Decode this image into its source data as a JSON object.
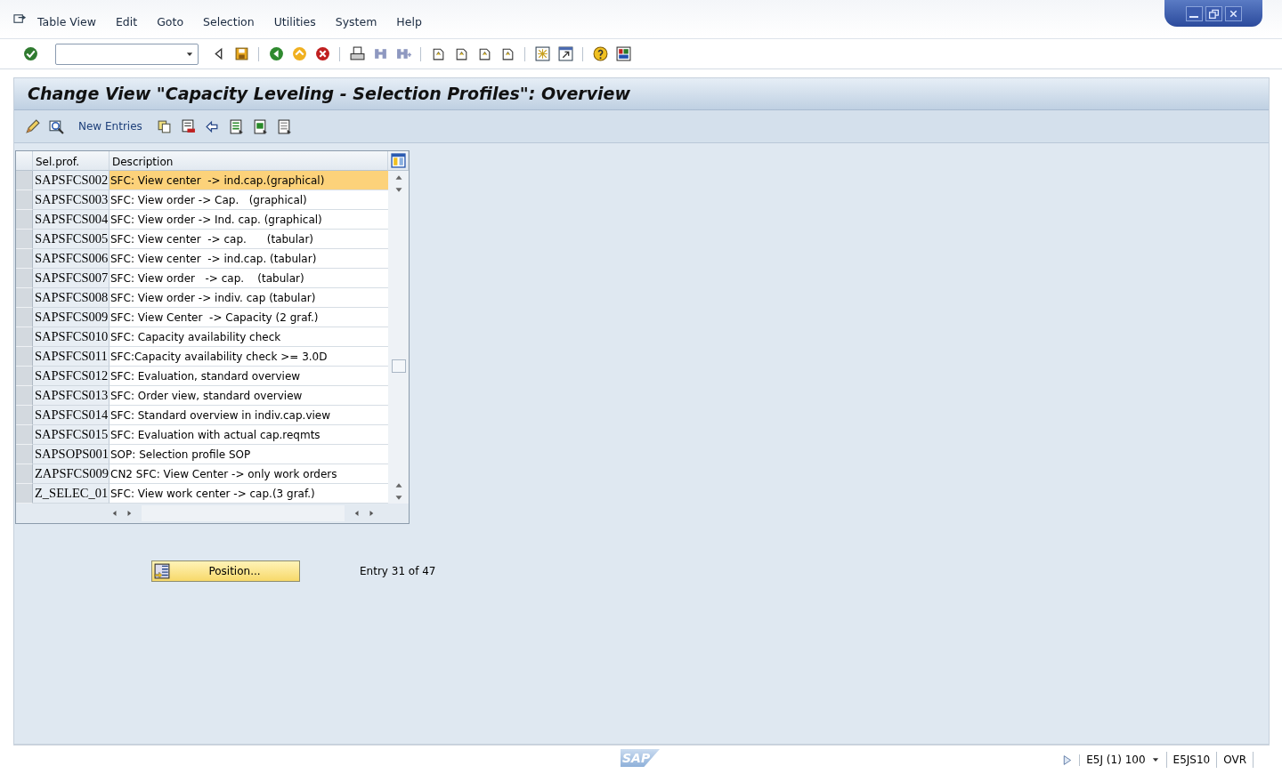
{
  "menu": [
    "Table View",
    "Edit",
    "Goto",
    "Selection",
    "Utilities",
    "System",
    "Help"
  ],
  "title": "Change View \"Capacity Leveling - Selection Profiles\": Overview",
  "app_toolbar": {
    "new_entries": "New Entries"
  },
  "table": {
    "columns": [
      "Sel.prof.",
      "Description"
    ],
    "rows": [
      {
        "profile": "SAPSFCS002",
        "description": "SFC: View center  -> ind.cap.(graphical)",
        "selected": true
      },
      {
        "profile": "SAPSFCS003",
        "description": "SFC: View order -> Cap.   (graphical)",
        "selected": false
      },
      {
        "profile": "SAPSFCS004",
        "description": "SFC: View order -> Ind. cap. (graphical)",
        "selected": false
      },
      {
        "profile": "SAPSFCS005",
        "description": "SFC: View center  -> cap.      (tabular)",
        "selected": false
      },
      {
        "profile": "SAPSFCS006",
        "description": "SFC: View center  -> ind.cap. (tabular)",
        "selected": false
      },
      {
        "profile": "SAPSFCS007",
        "description": "SFC: View order   -> cap.    (tabular)",
        "selected": false
      },
      {
        "profile": "SAPSFCS008",
        "description": "SFC: View order -> indiv. cap (tabular)",
        "selected": false
      },
      {
        "profile": "SAPSFCS009",
        "description": "SFC: View Center  -> Capacity (2 graf.)",
        "selected": false
      },
      {
        "profile": "SAPSFCS010",
        "description": "SFC: Capacity availability check",
        "selected": false
      },
      {
        "profile": "SAPSFCS011",
        "description": "SFC:Capacity availability check >= 3.0D",
        "selected": false
      },
      {
        "profile": "SAPSFCS012",
        "description": "SFC: Evaluation, standard overview",
        "selected": false
      },
      {
        "profile": "SAPSFCS013",
        "description": "SFC: Order view, standard overview",
        "selected": false
      },
      {
        "profile": "SAPSFCS014",
        "description": "SFC: Standard overview in indiv.cap.view",
        "selected": false
      },
      {
        "profile": "SAPSFCS015",
        "description": "SFC: Evaluation with actual cap.reqmts",
        "selected": false
      },
      {
        "profile": "SAPSOPS001",
        "description": "SOP: Selection profile SOP",
        "selected": false
      },
      {
        "profile": "ZAPSFCS009",
        "description": "CN2 SFC: View Center -> only work orders",
        "selected": false
      },
      {
        "profile": "Z_SELEC_01",
        "description": "SFC: View work center -> cap.(3 graf.)",
        "selected": false
      }
    ]
  },
  "position_button": "Position...",
  "entry_info": "Entry 31 of 47",
  "status_bar": {
    "logo": "SAP",
    "system": "E5J (1) 100",
    "server": "E5JS10",
    "mode": "OVR"
  }
}
